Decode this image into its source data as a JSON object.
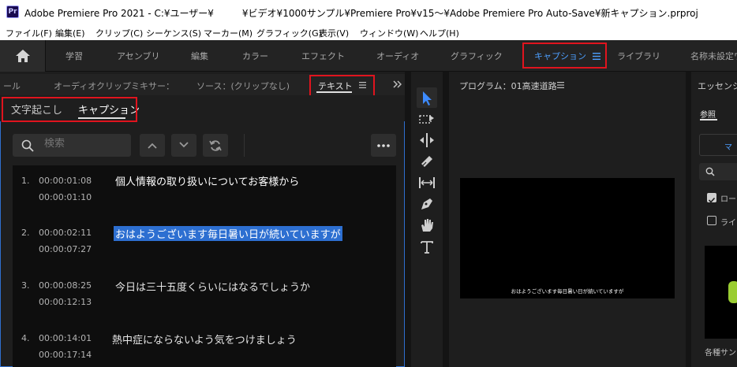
{
  "window": {
    "title": "Adobe Premiere Pro 2021 - C:¥ユーザー¥　　　¥ビデオ¥1000サンプル¥Premiere Pro¥v15～¥Adobe Premiere Pro Auto-Save¥新キャプション.prproj",
    "app_icon": "Pr"
  },
  "menu": [
    "ファイル(F)",
    "編集(E)",
    "クリップ(C)",
    "シーケンス(S)",
    "マーカー(M)",
    "グラフィック(G)",
    "表示(V)",
    "ウィンドウ(W)",
    "ヘルプ(H)"
  ],
  "workspaces": [
    "学習",
    "アセンブリ",
    "編集",
    "カラー",
    "エフェクト",
    "オーディオ",
    "グラフィック",
    "キャプション",
    "ライブラリ",
    "名称未設定ワ"
  ],
  "active_workspace": "キャプション",
  "panel_tabs": {
    "tab1": "ール",
    "tab2": "オーディオクリップミキサー：",
    "tab3": "ソース：(クリップなし)",
    "tab4": "テキスト"
  },
  "subtabs": {
    "transcript": "文字起こし",
    "captions": "キャプション"
  },
  "search": {
    "placeholder": "検索"
  },
  "captions": [
    {
      "num": "1.",
      "in": "00:00:01:08",
      "out": "00:00:01:10",
      "text": "個人情報の取り扱いについてお客様から"
    },
    {
      "num": "2.",
      "in": "00:00:02:11",
      "out": "00:00:07:27",
      "text": "おはようございます毎日暑い日が続いていますが"
    },
    {
      "num": "3.",
      "in": "00:00:08:25",
      "out": "00:00:12:13",
      "text": "今日は三十五度くらいにはなるでしょうか"
    },
    {
      "num": "4.",
      "in": "00:00:14:01",
      "out": "00:00:17:14",
      "text": "熱中症にならないよう気をつけましょう"
    }
  ],
  "program": {
    "title": "プログラム：01高速道路",
    "subtitle": "おはようございます毎日暑い日が続いていますが"
  },
  "essential": {
    "title": "エッセンシ",
    "tab_browse": "参照",
    "btn": "マ",
    "check1": "ロー",
    "check2": "ライ",
    "footer": "各種サン"
  },
  "colors": {
    "accent": "#4d9fff",
    "highlight": "#e0141e",
    "selection": "#2d6fd1"
  }
}
